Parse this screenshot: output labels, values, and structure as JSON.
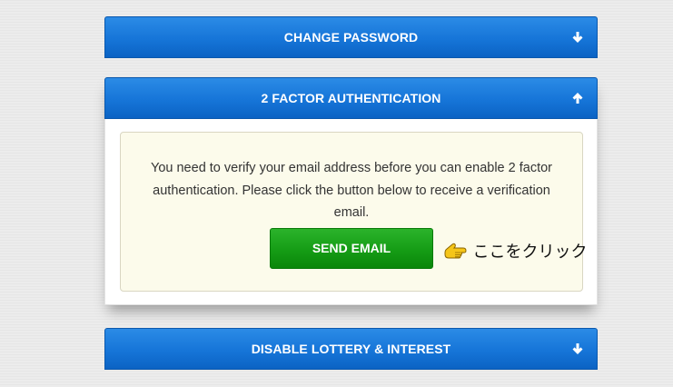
{
  "panels": {
    "change_password": {
      "title": "CHANGE PASSWORD",
      "icon": "arrow-down-icon",
      "expanded": false
    },
    "two_factor": {
      "title": "2 FACTOR AUTHENTICATION",
      "icon": "arrow-up-icon",
      "expanded": true,
      "notice": "You need to verify your email address before you can enable 2 factor authentication. Please click the button below to receive a verification email.",
      "send_button_label": "SEND EMAIL",
      "hint_icon": "pointing-hand-icon",
      "hint_text": "ここをクリック"
    },
    "disable_lottery": {
      "title": "DISABLE LOTTERY & INTEREST",
      "icon": "arrow-down-icon",
      "expanded": false
    }
  },
  "colors": {
    "header_blue": "#1675d8",
    "button_green": "#159c15",
    "notice_bg": "#fcfbeb",
    "page_bg": "#ececec"
  }
}
